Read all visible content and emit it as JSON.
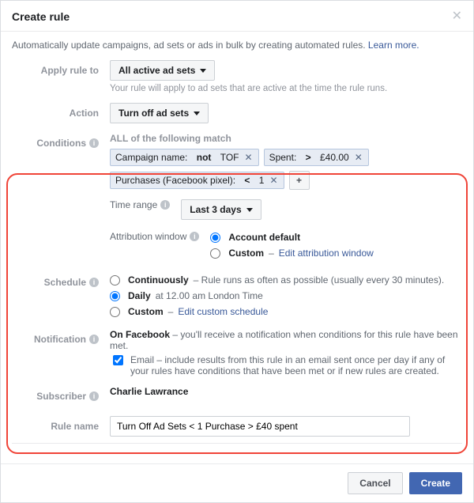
{
  "header": {
    "title": "Create rule"
  },
  "intro": {
    "text": "Automatically update campaigns, ad sets or ads in bulk by creating automated rules. ",
    "link": "Learn more."
  },
  "labels": {
    "apply": "Apply rule to",
    "action": "Action",
    "conditions": "Conditions",
    "schedule": "Schedule",
    "notification": "Notification",
    "subscriber": "Subscriber",
    "rulename": "Rule name"
  },
  "apply": {
    "value": "All active ad sets",
    "hint": "Your rule will apply to ad sets that are active at the time the rule runs."
  },
  "action": {
    "value": "Turn off ad sets"
  },
  "conditions": {
    "all_text": "ALL of the following match",
    "chips": [
      {
        "label": "Campaign name:",
        "op": "not",
        "val": "TOF"
      },
      {
        "label": "Spent:",
        "op": ">",
        "val": "£40.00"
      },
      {
        "label": "Purchases (Facebook pixel):",
        "op": "<",
        "val": "1"
      }
    ],
    "timerange_label": "Time range",
    "timerange_value": "Last 3 days",
    "attrib_label": "Attribution window",
    "attrib_opts": {
      "default": "Account default",
      "custom": "Custom",
      "edit_link": "Edit attribution window"
    }
  },
  "schedule": {
    "continuous": {
      "title": "Continuously",
      "desc": " – Rule runs as often as possible (usually every 30 minutes)."
    },
    "daily": {
      "title": "Daily",
      "desc": " at 12.00 am London Time"
    },
    "custom": {
      "title": "Custom",
      "edit_link": "Edit custom schedule"
    }
  },
  "notification": {
    "fb_title": "On Facebook",
    "fb_desc": " – you'll receive a notification when conditions for this rule have been met.",
    "email_title": "Email",
    "email_desc": " – include results from this rule in an email sent once per day if any of your rules have conditions that have been met or if new rules are created."
  },
  "subscriber": {
    "name": "Charlie Lawrance"
  },
  "rulename": {
    "value": "Turn Off Ad Sets < 1 Purchase > £40 spent"
  },
  "footer": {
    "cancel": "Cancel",
    "create": "Create"
  }
}
